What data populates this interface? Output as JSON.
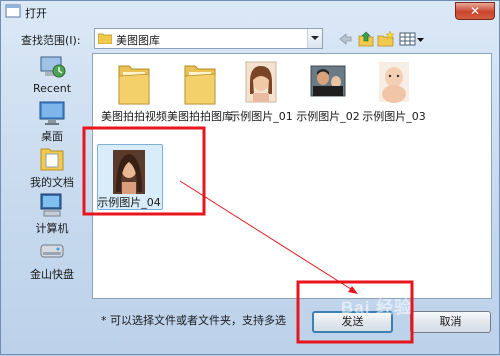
{
  "window": {
    "title": "打开",
    "close_symbol": "✕"
  },
  "toolbar": {
    "lookin_label": "查找范围(I):",
    "current_folder": "美图图库"
  },
  "places": [
    {
      "label": "Recent",
      "icon": "recent-places-icon"
    },
    {
      "label": "桌面",
      "icon": "desktop-icon"
    },
    {
      "label": "我的文档",
      "icon": "documents-icon"
    },
    {
      "label": "计算机",
      "icon": "computer-icon"
    },
    {
      "label": "金山快盘",
      "icon": "cloud-drive-icon"
    }
  ],
  "files": [
    {
      "name": "美图拍拍视频",
      "kind": "folder"
    },
    {
      "name": "美图拍拍图库",
      "kind": "folder"
    },
    {
      "name": "示例图片_01",
      "kind": "image"
    },
    {
      "name": "示例图片_02",
      "kind": "image"
    },
    {
      "name": "示例图片_03",
      "kind": "image"
    },
    {
      "name": "示例图片_04",
      "kind": "image",
      "selected": true
    }
  ],
  "footer": {
    "hint": "* 可以选择文件或者文件夹，支持多选",
    "send_label": "发送",
    "cancel_label": "取消"
  },
  "watermark": "Bai 经验",
  "colors": {
    "annotation_red": "#e8161c",
    "title_gradient_top": "#dbe8f6",
    "selection_fill": "#cde6f7"
  }
}
